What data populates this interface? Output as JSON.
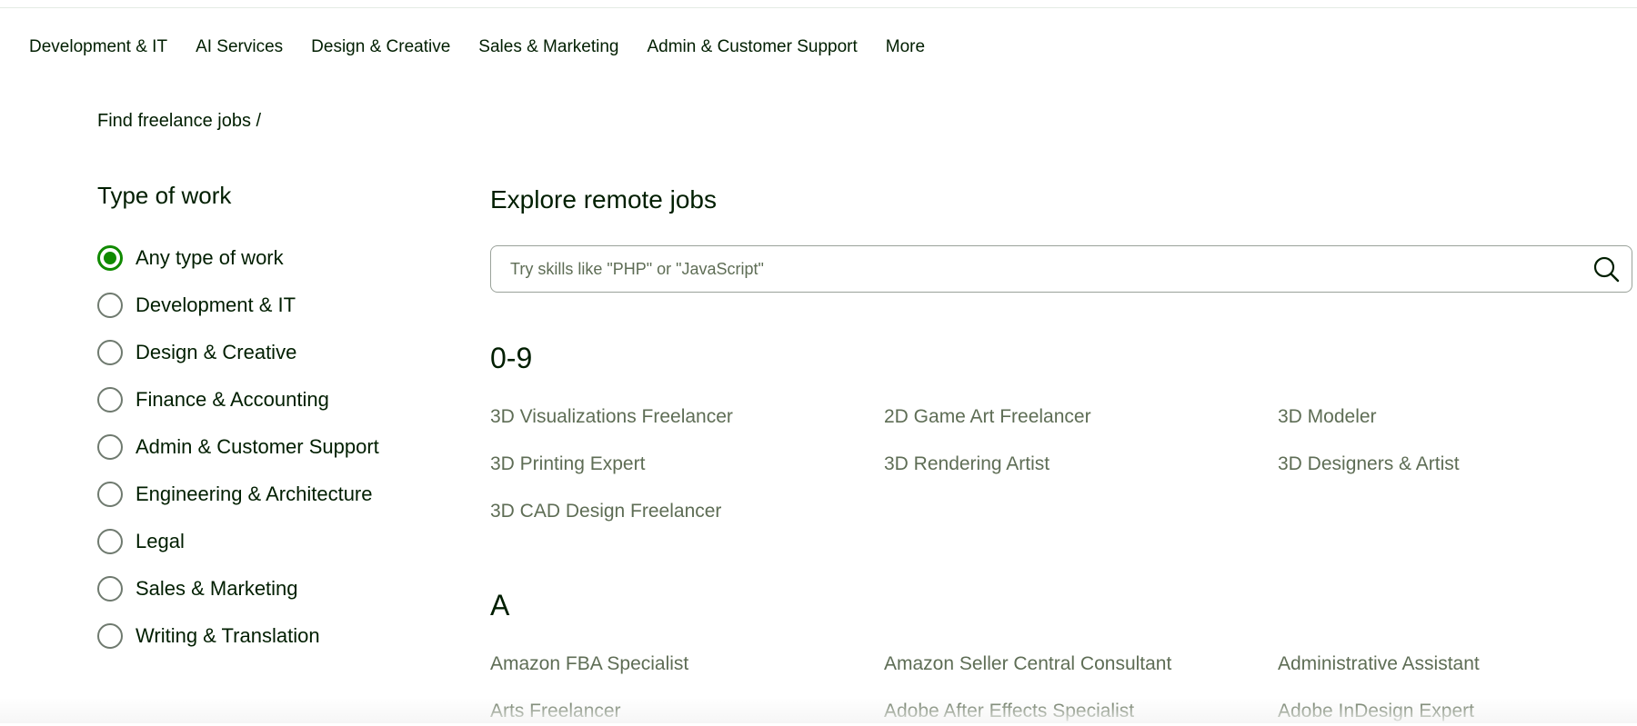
{
  "nav": {
    "items": [
      "Development & IT",
      "AI Services",
      "Design & Creative",
      "Sales & Marketing",
      "Admin & Customer Support",
      "More"
    ]
  },
  "breadcrumb": "Find freelance jobs /",
  "sidebar": {
    "title": "Type of work",
    "options": [
      {
        "label": "Any type of work",
        "checked": true
      },
      {
        "label": "Development & IT",
        "checked": false
      },
      {
        "label": "Design & Creative",
        "checked": false
      },
      {
        "label": "Finance & Accounting",
        "checked": false
      },
      {
        "label": "Admin & Customer Support",
        "checked": false
      },
      {
        "label": "Engineering & Architecture",
        "checked": false
      },
      {
        "label": "Legal",
        "checked": false
      },
      {
        "label": "Sales & Marketing",
        "checked": false
      },
      {
        "label": "Writing & Translation",
        "checked": false
      }
    ]
  },
  "main": {
    "title": "Explore remote jobs",
    "search": {
      "placeholder": "Try skills like \"PHP\" or \"JavaScript\"",
      "value": "",
      "icon": "search-icon"
    },
    "sections": [
      {
        "heading": "0-9",
        "jobs": [
          "3D Visualizations Freelancer",
          "2D Game Art Freelancer",
          "3D Modeler",
          "3D Printing Expert",
          "3D Rendering Artist",
          "3D Designers & Artist",
          "3D CAD Design Freelancer"
        ]
      },
      {
        "heading": "A",
        "jobs": [
          "Amazon FBA Specialist",
          "Amazon Seller Central Consultant",
          "Administrative Assistant",
          "Arts Freelancer",
          "Adobe After Effects Specialist",
          "Adobe InDesign Expert"
        ]
      }
    ]
  },
  "colors": {
    "accent": "#108a00",
    "text": "#001e00",
    "muted": "#5e6d55"
  }
}
